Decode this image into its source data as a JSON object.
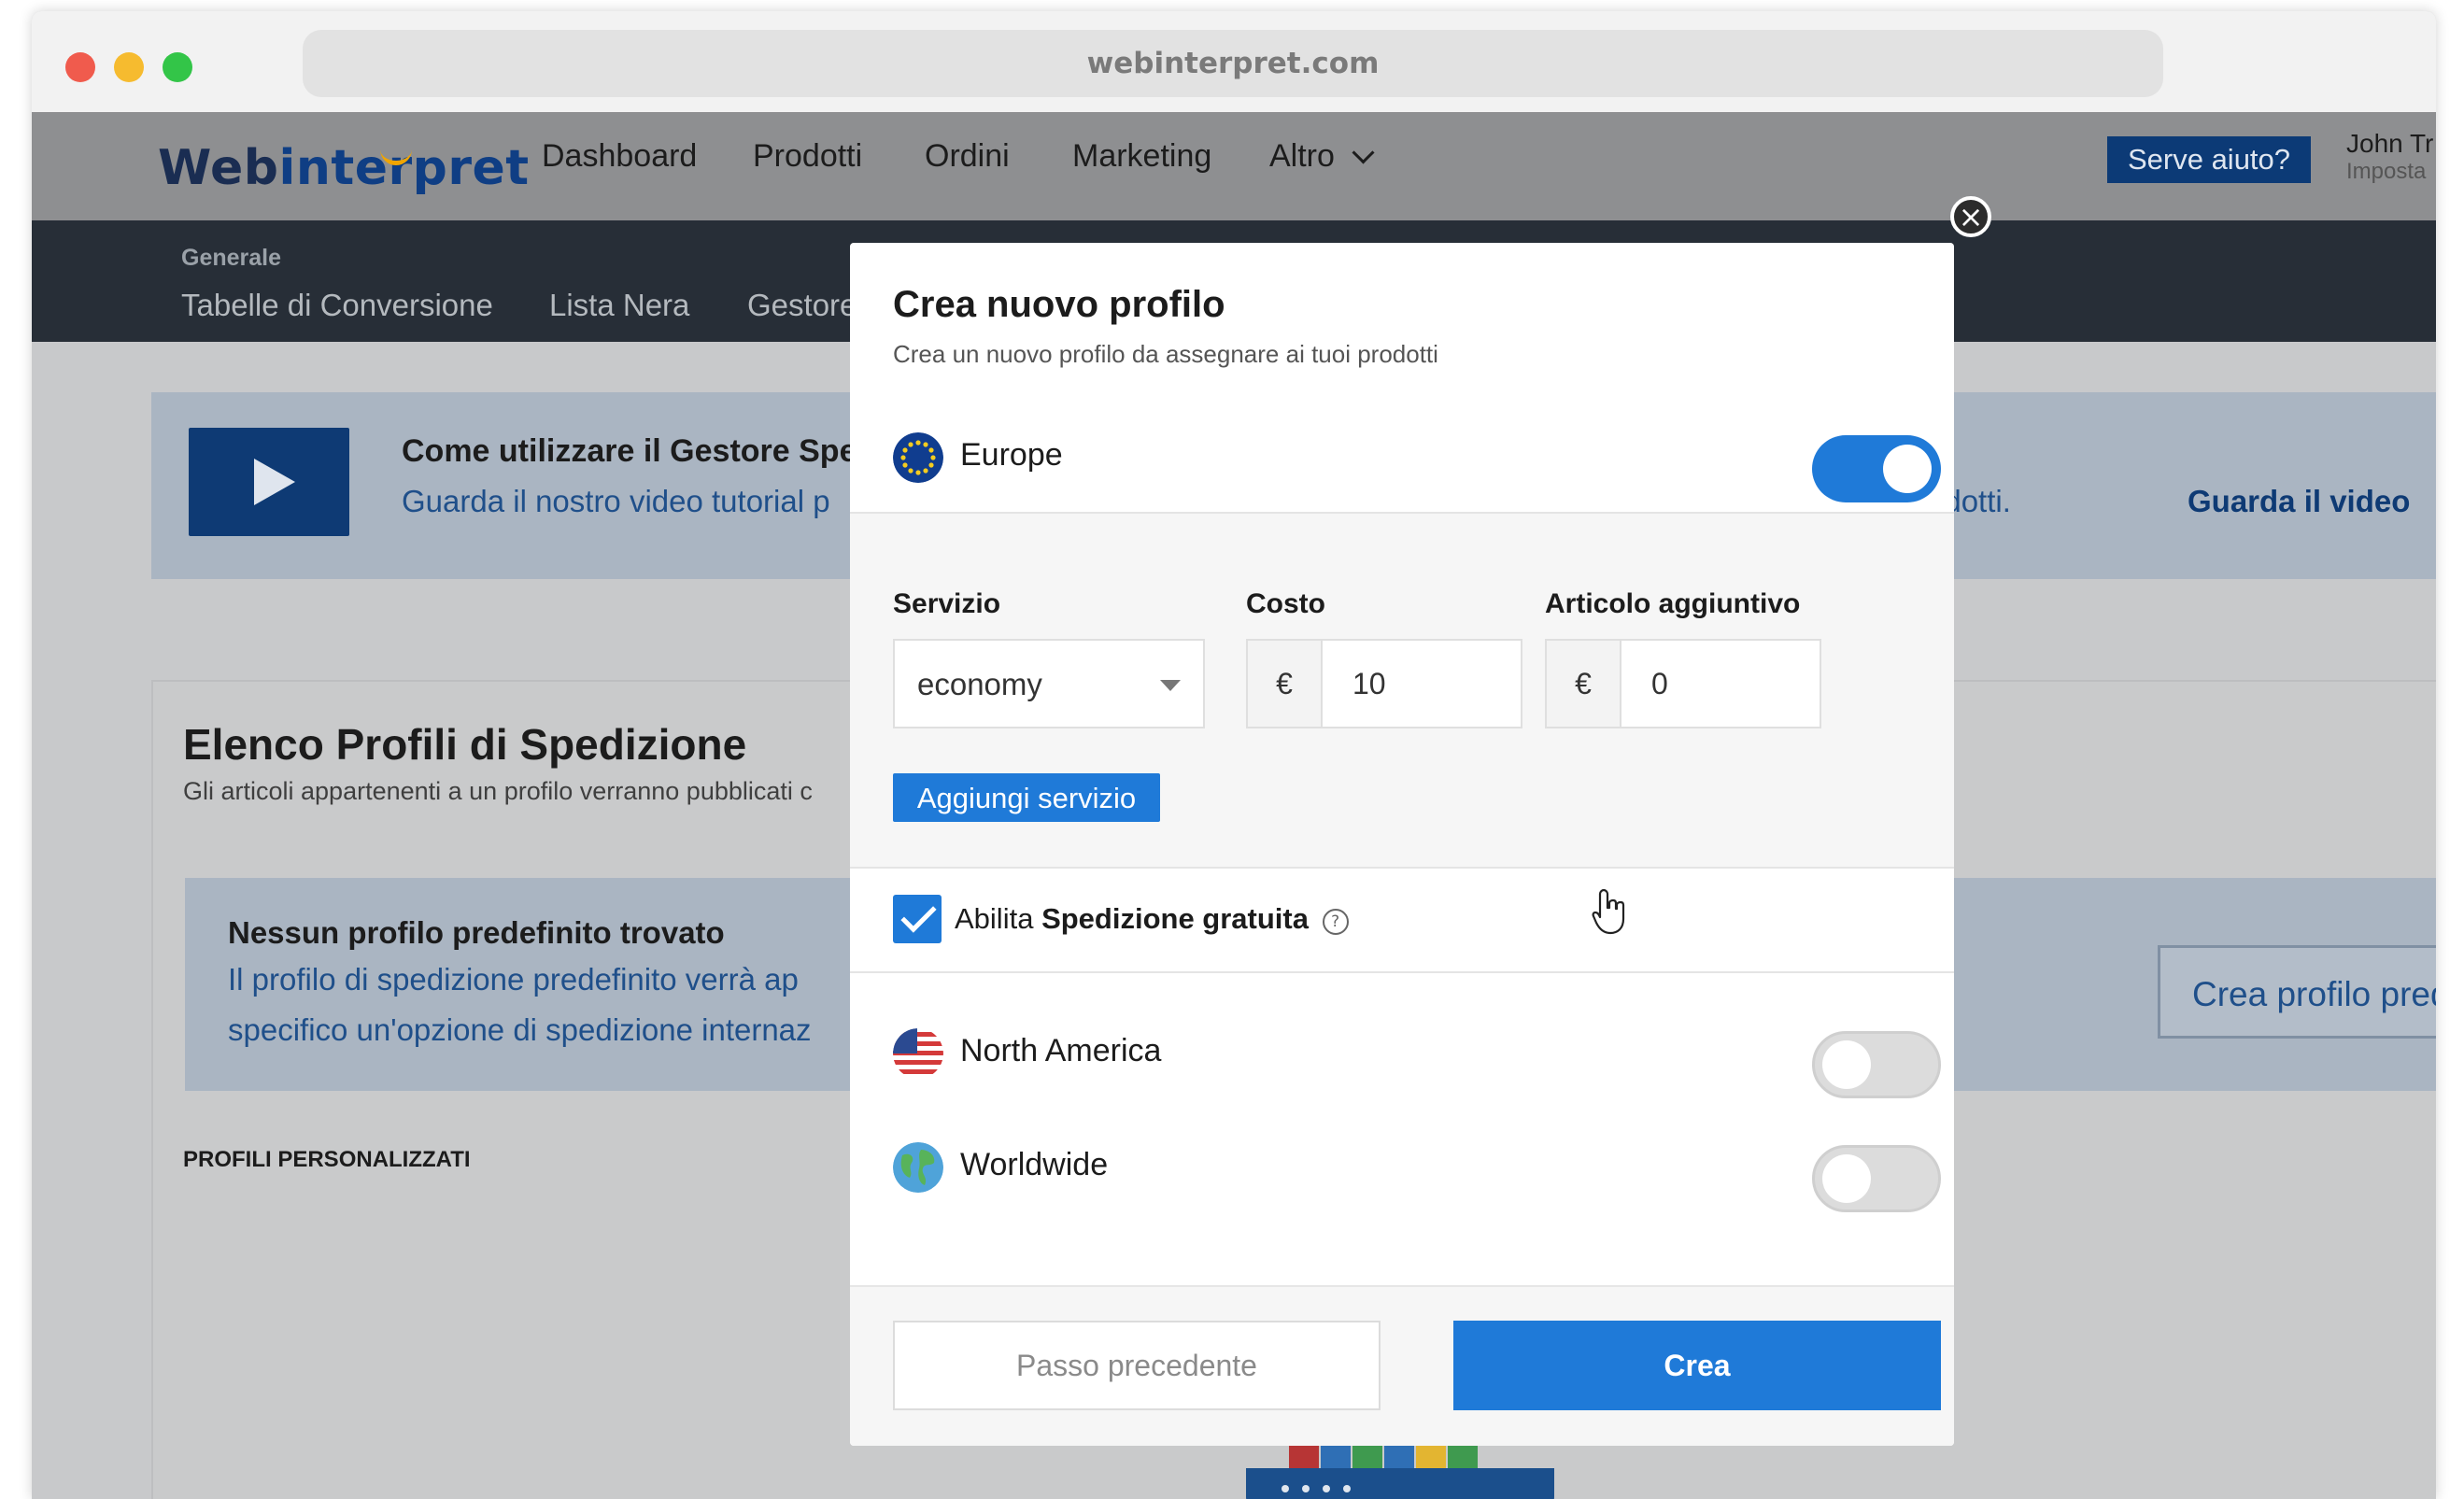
{
  "browser": {
    "url": "webinterpret.com"
  },
  "app": {
    "logo_part1": "Web",
    "logo_part2": "interpret",
    "nav": [
      "Dashboard",
      "Prodotti",
      "Ordini",
      "Marketing",
      "Altro"
    ],
    "help_label": "Serve aiuto?",
    "user_name": "John Tr",
    "user_sub": "Imposta"
  },
  "subnav": {
    "heading": "Generale",
    "links": [
      "Tabelle di Conversione",
      "Lista Nera",
      "Gestore"
    ]
  },
  "video_banner": {
    "title": "Come utilizzare il Gestore Spedi",
    "subtitle": "Guarda il nostro video tutorial p",
    "right_text": "rodotti.",
    "link": "Guarda il video"
  },
  "profiles": {
    "title": "Elenco Profili di Spedizione",
    "subtitle": "Gli articoli appartenenti a un profilo verranno pubblicati c",
    "empty_title": "Nessun profilo predefinito trovato",
    "empty_text_1": "Il profilo di spedizione predefinito verrà ap",
    "empty_text_2": "specifico un'opzione di spedizione internaz",
    "default_button": "Crea profilo pred",
    "custom_label": "PROFILI PERSONALIZZATI"
  },
  "modal": {
    "close_glyph": "×",
    "title": "Crea nuovo profilo",
    "subtitle": "Crea un nuovo profilo da assegnare ai tuoi prodotti",
    "regions": [
      {
        "name": "Europe",
        "enabled": true
      },
      {
        "name": "North America",
        "enabled": false
      },
      {
        "name": "Worldwide",
        "enabled": false
      }
    ],
    "service": {
      "service_label": "Servizio",
      "service_value": "economy",
      "cost_label": "Costo",
      "cost_currency": "€",
      "cost_value": "10",
      "extra_label": "Articolo aggiuntivo",
      "extra_currency": "€",
      "extra_value": "0",
      "add_service_label": "Aggiungi servizio"
    },
    "free_shipping": {
      "checked": true,
      "prefix": "Abilita",
      "bold": "Spedizione gratuita",
      "help_glyph": "?"
    },
    "footer": {
      "prev_label": "Passo precedente",
      "create_label": "Crea"
    }
  },
  "colors": {
    "accent": "#1f7ad8",
    "brand_dark": "#0e3a74"
  }
}
